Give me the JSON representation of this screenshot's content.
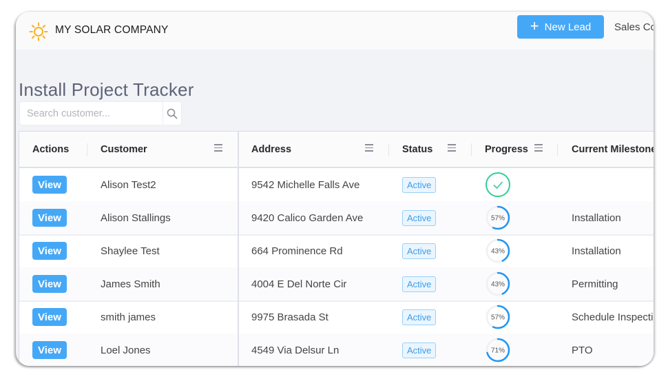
{
  "app": {
    "brand": "MY SOLAR COMPANY",
    "new_lead_label": "New Lead",
    "sales_link_label": "Sales Co",
    "colors": {
      "accent": "#45a8f7",
      "sun": "#f7b21c",
      "complete": "#2fcf98",
      "progress": "#2196f3"
    }
  },
  "page": {
    "title": "Install Project Tracker",
    "search_placeholder": "Search customer...",
    "search_value": ""
  },
  "table": {
    "columns": [
      {
        "label": "Actions"
      },
      {
        "label": "Customer"
      },
      {
        "label": "Address"
      },
      {
        "label": "Status"
      },
      {
        "label": "Progress"
      },
      {
        "label": "Current Milestone"
      }
    ],
    "rows": [
      {
        "action": "View",
        "customer": "Alison Test2",
        "address": "9542 Michelle Falls Ave",
        "status": "Active",
        "progress": 100,
        "progress_label": "",
        "complete": true,
        "milestone": ""
      },
      {
        "action": "View",
        "customer": "Alison Stallings",
        "address": "9420 Calico Garden Ave",
        "status": "Active",
        "progress": 57,
        "progress_label": "57%",
        "complete": false,
        "milestone": "Installation"
      },
      {
        "action": "View",
        "customer": "Shaylee Test",
        "address": "664 Prominence Rd",
        "status": "Active",
        "progress": 43,
        "progress_label": "43%",
        "complete": false,
        "milestone": "Installation"
      },
      {
        "action": "View",
        "customer": "James Smith",
        "address": "4004 E Del Norte Cir",
        "status": "Active",
        "progress": 43,
        "progress_label": "43%",
        "complete": false,
        "milestone": "Permitting"
      },
      {
        "action": "View",
        "customer": "smith james",
        "address": "9975 Brasada St",
        "status": "Active",
        "progress": 57,
        "progress_label": "57%",
        "complete": false,
        "milestone": "Schedule Inspection"
      },
      {
        "action": "View",
        "customer": "Loel Jones",
        "address": "4549 Via Delsur Ln",
        "status": "Active",
        "progress": 71,
        "progress_label": "71%",
        "complete": false,
        "milestone": "PTO"
      }
    ]
  }
}
